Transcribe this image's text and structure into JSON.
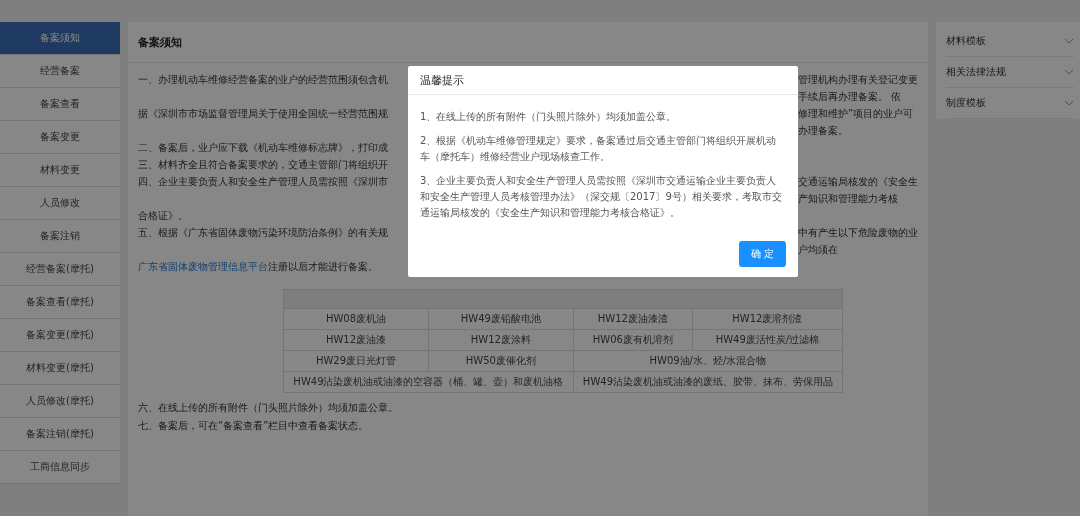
{
  "sidebar": {
    "items": [
      {
        "label": "备案须知",
        "selected": true
      },
      {
        "label": "经营备案",
        "selected": false
      },
      {
        "label": "备案查看",
        "selected": false
      },
      {
        "label": "备案变更",
        "selected": false
      },
      {
        "label": "材料变更",
        "selected": false
      },
      {
        "label": "人员修改",
        "selected": false
      },
      {
        "label": "备案注销",
        "selected": false
      },
      {
        "label": "经营备案(摩托)",
        "selected": false
      },
      {
        "label": "备案查看(摩托)",
        "selected": false
      },
      {
        "label": "备案变更(摩托)",
        "selected": false
      },
      {
        "label": "材料变更(摩托)",
        "selected": false
      },
      {
        "label": "人员修改(摩托)",
        "selected": false
      },
      {
        "label": "备案注销(摩托)",
        "selected": false
      },
      {
        "label": "工商信息同步",
        "selected": false
      }
    ]
  },
  "notice": {
    "title": "备案须知",
    "lines": [
      {
        "left": "一、办理机动车维修经营备案的业户的经营范围须包含机",
        "right": "管理机构办理有关登记变更手续后再办理备案。 依"
      },
      {
        "left": "据《深圳市市场监督管理局关于使用全国统一经营范围规",
        "right": "修理和维护”项目的业户可办理备案。"
      },
      {
        "left": "二、备案后，业户应下载《机动车维修标志牌》，打印成"
      },
      {
        "left": "三、材料齐全且符合备案要求的，交通主管部门将组织开"
      },
      {
        "left": "四、企业主要负责人和安全生产管理人员需按照《深圳市",
        "right": "交通运输局核发的《安全生产知识和管理能力考核"
      },
      {
        "left": "合格证》。"
      },
      {
        "left": "五、根据《广东省固体废物污染环境防治条例》的有关规",
        "right": "中有产生以下危险废物的业户均须在"
      },
      {
        "link": "广东省固体废物管理信息平台",
        "left": "注册以后才能进行备案。"
      }
    ],
    "table": {
      "rows": [
        [
          {
            "text": "HW08废机油"
          },
          {
            "text": "HW49废铅酸电池"
          },
          {
            "text": "HW12废油漆渣"
          },
          {
            "text": "HW12废溶剂渣"
          }
        ],
        [
          {
            "text": "HW12废油漆"
          },
          {
            "text": "HW12废涂料"
          },
          {
            "text": "HW06废有机溶剂"
          },
          {
            "text": "HW49废活性炭/过滤棉"
          }
        ],
        [
          {
            "text": "HW29废日光灯管"
          },
          {
            "text": "HW50废催化剂"
          },
          {
            "text": "HW09油/水、烃/水混合物",
            "colspan": 2
          }
        ],
        [
          {
            "text": "HW49沾染废机油或油漆的空容器（桶、罐、壶）和废机油格",
            "colspan": 2
          },
          {
            "text": "HW49沾染废机油或油漆的废纸、胶带、抹布、劳保用品",
            "colspan": 2
          }
        ]
      ]
    },
    "footer_lines": [
      "六、在线上传的所有附件（门头照片除外）均须加盖公章。",
      "七、备案后，可在“备案查看”栏目中查看备案状态。"
    ]
  },
  "resources": [
    {
      "label": "材料模板",
      "expanded": false
    },
    {
      "label": "相关法律法规",
      "expanded": false
    },
    {
      "label": "制度模板",
      "expanded": false
    }
  ],
  "dialog": {
    "title": "温馨提示",
    "paragraphs": [
      "1、在线上传的所有附件（门头照片除外）均须加盖公章。",
      "2、根据《机动车维修管理规定》要求，备案通过后交通主管部门将组织开展机动车（摩托车）维修经营业户现场核查工作。",
      "3、企业主要负责人和安全生产管理人员需按照《深圳市交通运输企业主要负责人和安全生产管理人员考核管理办法》（深交规〔2017〕9号）相关要求，考取市交通运输局核发的《安全生产知识和管理能力考核合格证》。"
    ],
    "button": "确 定"
  }
}
